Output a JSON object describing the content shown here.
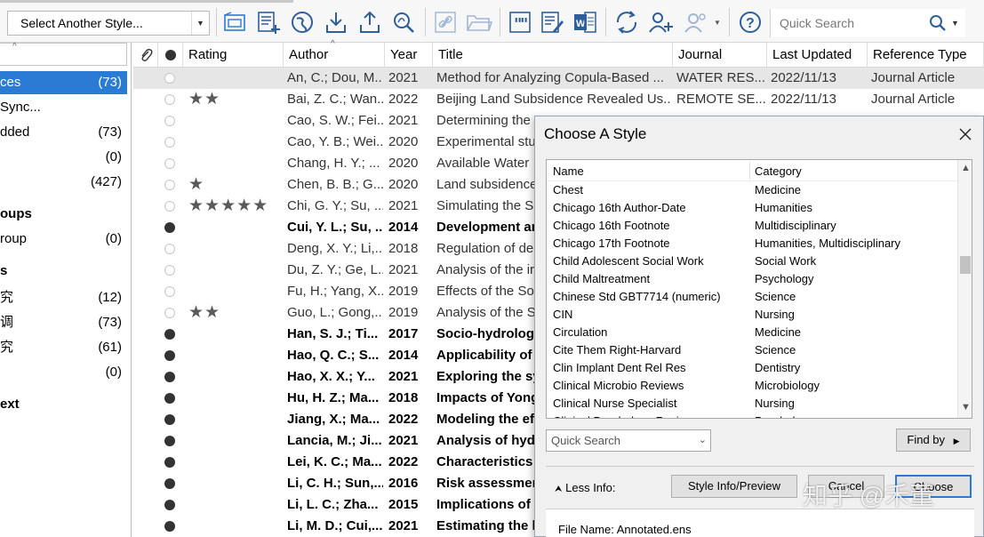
{
  "toolbar": {
    "style_select": "Select Another Style...",
    "search_placeholder": "Quick Search"
  },
  "left_panel": {
    "items": [
      {
        "label": "ces",
        "count": "(73)"
      },
      {
        "label": "Sync...",
        "count": ""
      },
      {
        "label": "dded",
        "count": "(73)"
      },
      {
        "label": "",
        "count": "(0)"
      },
      {
        "label": "",
        "count": "(427)"
      },
      {
        "label": "oups",
        "count": ""
      },
      {
        "label": "roup",
        "count": "(0)"
      },
      {
        "label": "s",
        "count": ""
      },
      {
        "label": "究",
        "count": "(12)"
      },
      {
        "label": "调",
        "count": "(73)"
      },
      {
        "label": "究",
        "count": "(61)"
      },
      {
        "label": "",
        "count": "(0)"
      },
      {
        "label": "ext",
        "count": ""
      }
    ]
  },
  "ref_list": {
    "headers": {
      "rating": "Rating",
      "author": "Author",
      "year": "Year",
      "title": "Title",
      "journal": "Journal",
      "updated": "Last Updated",
      "type": "Reference Type"
    },
    "rows": [
      {
        "rating": "",
        "author": "An, C.; Dou, M...",
        "year": "2021",
        "title": "Method for Analyzing Copula-Based ...",
        "journal": "WATER RES...",
        "updated": "2022/11/13",
        "type": "Journal Article"
      },
      {
        "rating": "★★",
        "author": "Bai, Z. C.; Wan...",
        "year": "2022",
        "title": "Beijing Land Subsidence Revealed Us...",
        "journal": "REMOTE SE...",
        "updated": "2022/11/13",
        "type": "Journal Article"
      },
      {
        "rating": "",
        "author": "Cao, S. W.; Fei...",
        "year": "2021",
        "title": "Determining the",
        "journal": "",
        "updated": "",
        "type": ""
      },
      {
        "rating": "",
        "author": "Cao, Y. B.; Wei...",
        "year": "2020",
        "title": "Experimental stu",
        "journal": "",
        "updated": "",
        "type": ""
      },
      {
        "rating": "",
        "author": "Chang, H. Y.; ...",
        "year": "2020",
        "title": "Available Water",
        "journal": "",
        "updated": "",
        "type": ""
      },
      {
        "rating": "★",
        "author": "Chen, B. B.; G...",
        "year": "2020",
        "title": "Land subsidence",
        "journal": "",
        "updated": "",
        "type": ""
      },
      {
        "rating": "★★★★★",
        "author": "Chi, G. Y.; Su, ...",
        "year": "2021",
        "title": "Simulating the S",
        "journal": "",
        "updated": "",
        "type": ""
      },
      {
        "rating": "",
        "author": "Cui, Y. L.; Su, ...",
        "year": "2014",
        "title": "Development an",
        "journal": "",
        "updated": "",
        "type": ""
      },
      {
        "rating": "",
        "author": "Deng, X. Y.; Li,...",
        "year": "2018",
        "title": "Regulation of de",
        "journal": "",
        "updated": "",
        "type": ""
      },
      {
        "rating": "",
        "author": "Du, Z. Y.; Ge, L...",
        "year": "2021",
        "title": "Analysis of the ir",
        "journal": "",
        "updated": "",
        "type": ""
      },
      {
        "rating": "",
        "author": "Fu, H.; Yang, X...",
        "year": "2019",
        "title": "Effects of the So",
        "journal": "",
        "updated": "",
        "type": ""
      },
      {
        "rating": "★★",
        "author": "Guo, L.; Gong,...",
        "year": "2019",
        "title": "Analysis of the S",
        "journal": "",
        "updated": "",
        "type": ""
      },
      {
        "rating": "",
        "author": "Han, S. J.; Ti...",
        "year": "2017",
        "title": "Socio-hydrologi",
        "journal": "",
        "updated": "",
        "type": ""
      },
      {
        "rating": "",
        "author": "Hao, Q. C.; S...",
        "year": "2014",
        "title": "Applicability of",
        "journal": "",
        "updated": "",
        "type": ""
      },
      {
        "rating": "",
        "author": "Hao, X. X.; Y...",
        "year": "2021",
        "title": "Exploring the sy",
        "journal": "",
        "updated": "",
        "type": ""
      },
      {
        "rating": "",
        "author": "Hu, H. Z.; Ma...",
        "year": "2018",
        "title": "Impacts of Yong",
        "journal": "",
        "updated": "",
        "type": ""
      },
      {
        "rating": "",
        "author": "Jiang, X.; Ma...",
        "year": "2022",
        "title": "Modeling the ef",
        "journal": "",
        "updated": "",
        "type": ""
      },
      {
        "rating": "",
        "author": "Lancia, M.; Ji...",
        "year": "2021",
        "title": "Analysis of hydr",
        "journal": "",
        "updated": "",
        "type": ""
      },
      {
        "rating": "",
        "author": "Lei, K. C.; Ma...",
        "year": "2022",
        "title": "Characteristics",
        "journal": "",
        "updated": "",
        "type": ""
      },
      {
        "rating": "",
        "author": "Li, C. H.; Sun,...",
        "year": "2016",
        "title": "Risk assessment",
        "journal": "",
        "updated": "",
        "type": ""
      },
      {
        "rating": "",
        "author": "Li, L. C.; Zha...",
        "year": "2015",
        "title": "Implications of",
        "journal": "",
        "updated": "",
        "type": ""
      },
      {
        "rating": "",
        "author": "Li, M. D.; Cui,...",
        "year": "2021",
        "title": "Estimating the l",
        "journal": "",
        "updated": "",
        "type": ""
      }
    ]
  },
  "dialog": {
    "title": "Choose A Style",
    "col_name": "Name",
    "col_category": "Category",
    "styles": [
      {
        "name": "Chest",
        "category": "Medicine"
      },
      {
        "name": "Chicago 16th Author-Date",
        "category": "Humanities"
      },
      {
        "name": "Chicago 16th Footnote",
        "category": "Multidisciplinary"
      },
      {
        "name": "Chicago 17th Footnote",
        "category": "Humanities, Multidisciplinary"
      },
      {
        "name": "Child Adolescent Social Work",
        "category": "Social Work"
      },
      {
        "name": "Child Maltreatment",
        "category": "Psychology"
      },
      {
        "name": "Chinese Std GBT7714 (numeric)",
        "category": "Science"
      },
      {
        "name": "CIN",
        "category": "Nursing"
      },
      {
        "name": "Circulation",
        "category": "Medicine"
      },
      {
        "name": "Cite Them Right-Harvard",
        "category": "Science"
      },
      {
        "name": "Clin Implant Dent Rel Res",
        "category": "Dentistry"
      },
      {
        "name": "Clinical Microbio Reviews",
        "category": "Microbiology"
      },
      {
        "name": "Clinical Nurse Specialist",
        "category": "Nursing"
      },
      {
        "name": "Clinical Psychology Review",
        "category": "Psychology"
      }
    ],
    "search_placeholder": "Quick Search",
    "find_by": "Find by",
    "less_info": "Less Info:",
    "preview": "Style Info/Preview",
    "cancel": "Cancel",
    "choose": "Choose",
    "file_name": "File Name:  Annotated.ens"
  },
  "watermark": "知乎 @禾董",
  "colors": {
    "accent": "#2a7bd4",
    "selection": "#e6e6e6",
    "toolbar": "#f7f7f7",
    "dialog_bg": "#f0f0f0"
  }
}
